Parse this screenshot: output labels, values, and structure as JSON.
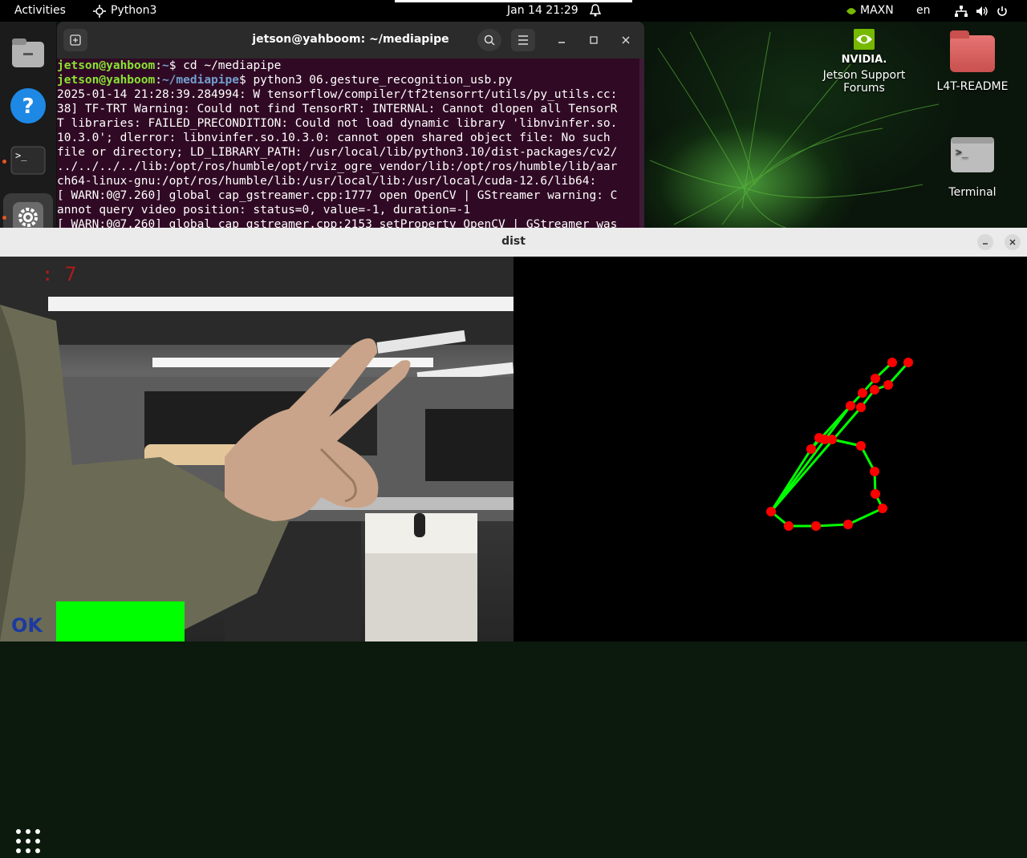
{
  "topbar": {
    "activities": "Activities",
    "app_name": "Python3",
    "clock": "Jan 14  21:29",
    "power_mode": "MAXN",
    "language": "en"
  },
  "desktop": {
    "icons": [
      {
        "label_line1": "Jetson Support",
        "label_line2": "Forums"
      },
      {
        "label": "L4T-README"
      },
      {
        "label": "Terminal"
      }
    ]
  },
  "terminal": {
    "title": "jetson@yahboom: ~/mediapipe",
    "prompt_user": "jetson@yahboom",
    "prompt_sep": ":",
    "prompt_home": "~",
    "prompt_mediapipe": "~/mediapipe",
    "cmd1": "$ cd ~/mediapipe",
    "cmd2": "$ python3 06.gesture_recognition_usb.py",
    "lines": [
      "2025-01-14 21:28:39.284994: W tensorflow/compiler/tf2tensorrt/utils/py_utils.cc:",
      "38] TF-TRT Warning: Could not find TensorRT: INTERNAL: Cannot dlopen all TensorR",
      "T libraries: FAILED_PRECONDITION: Could not load dynamic library 'libnvinfer.so.",
      "10.3.0'; dlerror: libnvinfer.so.10.3.0: cannot open shared object file: No such",
      "file or directory; LD_LIBRARY_PATH: /usr/local/lib/python3.10/dist-packages/cv2/",
      "../../../../lib:/opt/ros/humble/opt/rviz_ogre_vendor/lib:/opt/ros/humble/lib/aar",
      "ch64-linux-gnu:/opt/ros/humble/lib:/usr/local/lib:/usr/local/cuda-12.6/lib64:",
      "[ WARN:0@7.260] global cap_gstreamer.cpp:1777 open OpenCV | GStreamer warning: C",
      "annot query video position: status=0, value=-1, duration=-1",
      "[ WARN:0@7.260] global cap_gstreamer.cpp:2153 setProperty OpenCV | GStreamer was"
    ]
  },
  "dist": {
    "title": "dist",
    "fps_text": ": 7",
    "gesture_text": "OK"
  },
  "colors": {
    "terminal_bg": "#300a24",
    "prompt_user": "#8ae234",
    "prompt_path": "#729fcf",
    "landmark_point": "#ff0000",
    "landmark_line": "#00ff00",
    "gesture_bar": "#00ff00"
  }
}
